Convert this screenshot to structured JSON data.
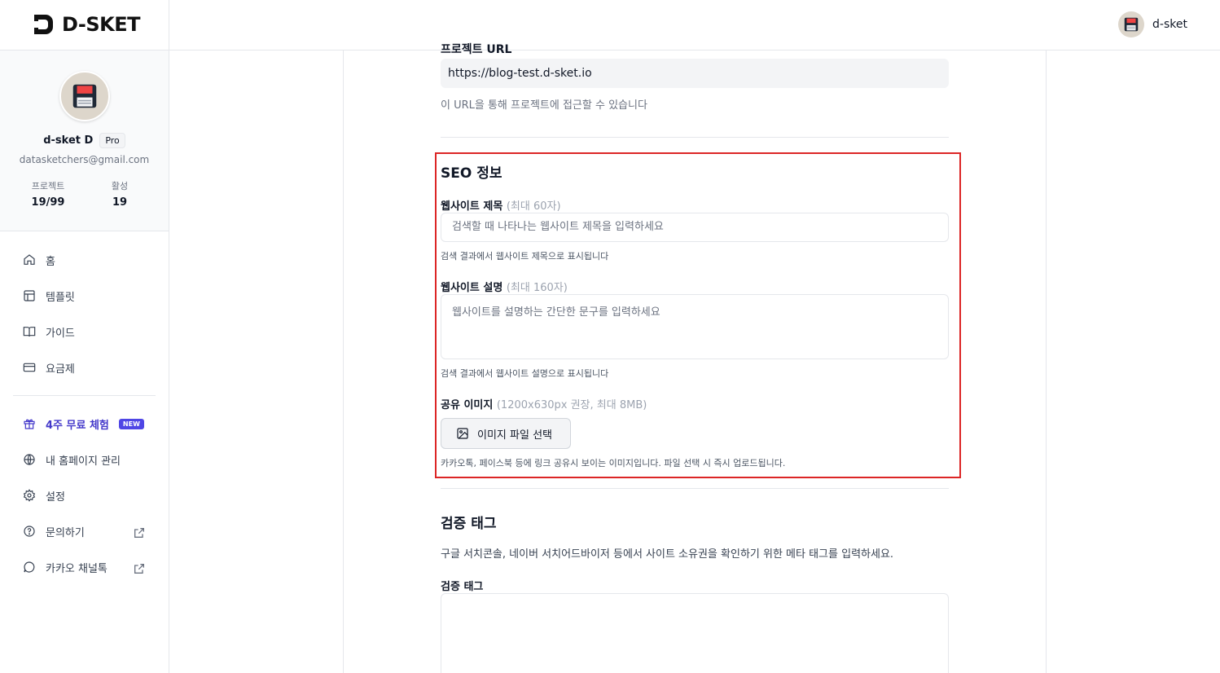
{
  "header": {
    "logo_text": "D-SKET",
    "user_name": "d-sket"
  },
  "profile": {
    "name": "d-sket D",
    "plan": "Pro",
    "email": "datasketchers@gmail.com",
    "stats": [
      {
        "label": "프로젝트",
        "value": "19/99"
      },
      {
        "label": "활성",
        "value": "19"
      }
    ]
  },
  "sidebar": {
    "items": [
      {
        "label": "홈",
        "icon": "home-icon"
      },
      {
        "label": "템플릿",
        "icon": "template-icon"
      },
      {
        "label": "가이드",
        "icon": "book-icon"
      },
      {
        "label": "요금제",
        "icon": "credit-card-icon"
      }
    ],
    "trial": {
      "label": "4주 무료 체험",
      "badge": "NEW",
      "icon": "gift-icon"
    },
    "secondary": [
      {
        "label": "내 홈페이지 관리",
        "icon": "globe-icon"
      },
      {
        "label": "설정",
        "icon": "gear-icon"
      },
      {
        "label": "문의하기",
        "icon": "help-circle-icon",
        "external": true
      },
      {
        "label": "카카오 채널톡",
        "icon": "chat-bubble-icon",
        "external": true
      }
    ]
  },
  "main": {
    "project_url": {
      "label": "프로젝트 URL",
      "value": "https://blog-test.d-sket.io",
      "help": "이 URL을 통해 프로젝트에 접근할 수 있습니다"
    },
    "seo": {
      "title": "SEO 정보",
      "site_title": {
        "label": "웹사이트 제목",
        "hint": "(최대 60자)",
        "placeholder": "검색할 때 나타나는 웹사이트 제목을 입력하세요",
        "help": "검색 결과에서 웹사이트 제목으로 표시됩니다"
      },
      "site_desc": {
        "label": "웹사이트 설명",
        "hint": "(최대 160자)",
        "placeholder": "웹사이트를 설명하는 간단한 문구를 입력하세요",
        "help": "검색 결과에서 웹사이트 설명으로 표시됩니다"
      },
      "share_image": {
        "label": "공유 이미지",
        "hint": "(1200x630px 권장, 최대 8MB)",
        "button": "이미지 파일 선택",
        "help": "카카오톡, 페이스북 등에 링크 공유시 보이는 이미지입니다. 파일 선택 시 즉시 업로드됩니다."
      }
    },
    "verify": {
      "title": "검증 태그",
      "desc": "구글 서치콘솔, 네이버 서치어드바이저 등에서 사이트 소유권을 확인하기 위한 메타 태그를 입력하세요.",
      "field_label": "검증 태그"
    }
  },
  "colors": {
    "accent": "#4f46e5",
    "highlight": "#dc2626"
  }
}
